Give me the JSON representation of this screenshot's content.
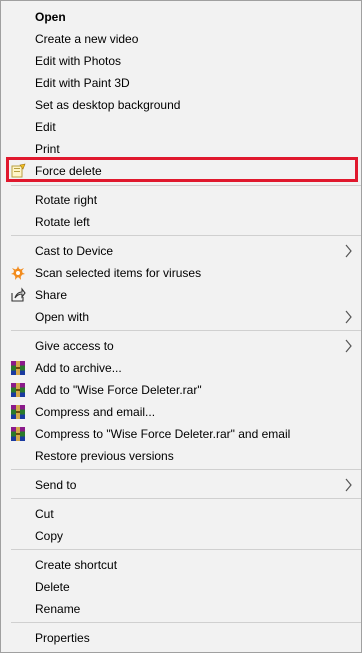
{
  "menu": {
    "open": "Open",
    "create_video": "Create a new video",
    "edit_photos": "Edit with Photos",
    "edit_paint3d": "Edit with Paint 3D",
    "set_background": "Set as desktop background",
    "edit": "Edit",
    "print": "Print",
    "force_delete": "Force delete",
    "rotate_right": "Rotate right",
    "rotate_left": "Rotate left",
    "cast_to_device": "Cast to Device",
    "scan_viruses": "Scan selected items for viruses",
    "share": "Share",
    "open_with": "Open with",
    "give_access": "Give access to",
    "add_archive": "Add to archive...",
    "add_rar": "Add to \"Wise Force Deleter.rar\"",
    "compress_email": "Compress and email...",
    "compress_rar_email": "Compress to \"Wise Force Deleter.rar\" and email",
    "restore_versions": "Restore previous versions",
    "send_to": "Send to",
    "cut": "Cut",
    "copy": "Copy",
    "create_shortcut": "Create shortcut",
    "delete": "Delete",
    "rename": "Rename",
    "properties": "Properties"
  },
  "colors": {
    "menu_background": "#f2f2f2",
    "highlight_border": "#e0182d",
    "avast_orange": "#f28c1e"
  },
  "icons": {
    "force_delete": "wise-force-deleter-icon",
    "scan": "avast-icon",
    "share": "share-icon",
    "archive": "winrar-icon",
    "submenu": "chevron-right-icon"
  }
}
